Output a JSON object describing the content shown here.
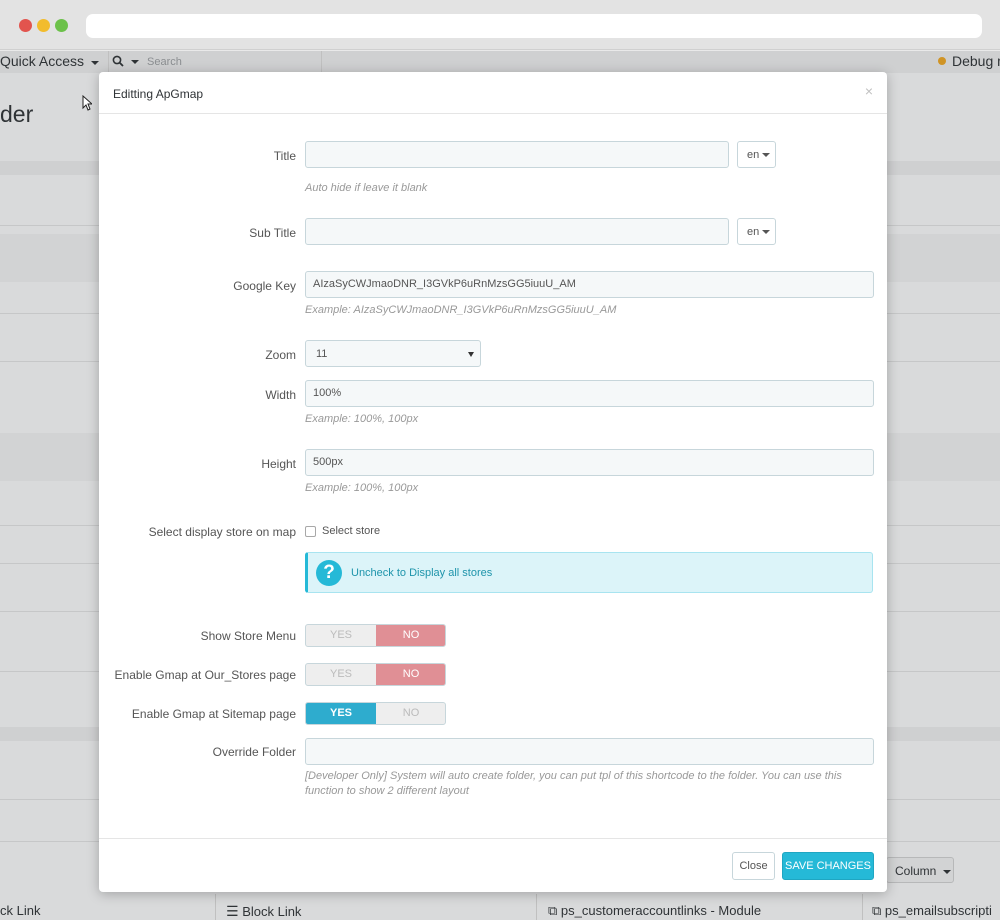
{
  "background": {
    "quick_access": "Quick Access",
    "search_placeholder": "Search",
    "debug": "Debug m",
    "heading": "der",
    "column_button": "Column",
    "bottom_items": [
      "ck Link",
      "Block Link",
      "ps_customeraccountlinks - Module",
      "ps_emailsubscripti"
    ]
  },
  "modal": {
    "title": "Editting ApGmap",
    "close_symbol": "×",
    "fields": {
      "title": {
        "label": "Title",
        "value": "",
        "lang": "en",
        "help": "Auto hide if leave it blank"
      },
      "sub_title": {
        "label": "Sub Title",
        "value": "",
        "lang": "en"
      },
      "google_key": {
        "label": "Google Key",
        "value": "AIzaSyCWJmaoDNR_I3GVkP6uRnMzsGG5iuuU_AM",
        "help": "Example: AIzaSyCWJmaoDNR_I3GVkP6uRnMzsGG5iuuU_AM"
      },
      "zoom": {
        "label": "Zoom",
        "value": "11"
      },
      "width": {
        "label": "Width",
        "value": "100%",
        "help": "Example: 100%, 100px"
      },
      "height": {
        "label": "Height",
        "value": "500px",
        "help": "Example: 100%, 100px"
      },
      "select_store": {
        "label": "Select display store on map",
        "checkbox_label": "Select store",
        "checked": false
      },
      "alert": {
        "icon": "?",
        "text": "Uncheck to Display all stores"
      },
      "show_store_menu": {
        "label": "Show Store Menu",
        "yes": "YES",
        "no": "NO",
        "value": "NO"
      },
      "enable_our_stores": {
        "label": "Enable Gmap at Our_Stores page",
        "yes": "YES",
        "no": "NO",
        "value": "NO"
      },
      "enable_sitemap": {
        "label": "Enable Gmap at Sitemap page",
        "yes": "YES",
        "no": "NO",
        "value": "YES"
      },
      "override_folder": {
        "label": "Override Folder",
        "value": "",
        "help_line1": "[Developer Only] System will auto create folder, you can put tpl of this shortcode to the folder. You can use this",
        "help_line2": "function to show 2 different layout"
      }
    },
    "footer": {
      "close": "Close",
      "save": "SAVE CHANGES"
    }
  },
  "colors": {
    "primary": "#25b9d7",
    "toggle_no": "#e08f95",
    "toggle_yes": "#2eacce"
  }
}
